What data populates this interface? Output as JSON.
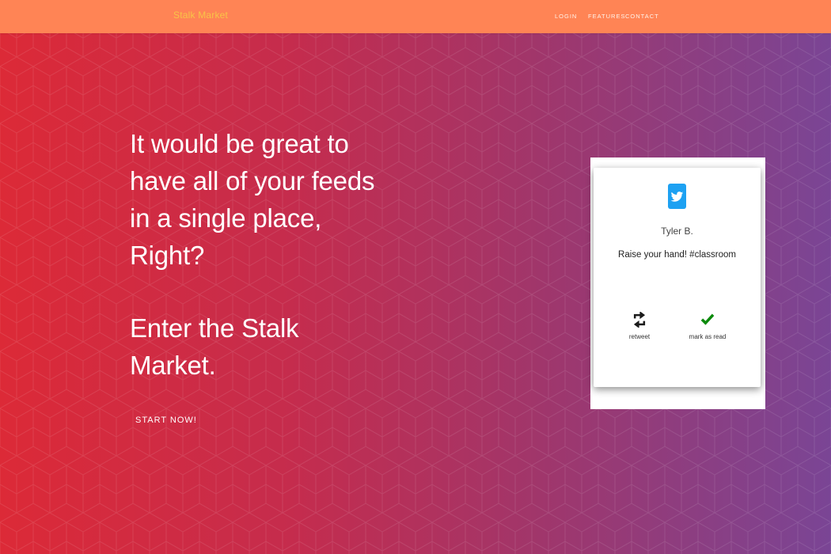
{
  "navbar": {
    "brand": "Stalk Market",
    "links": [
      "LOGIN",
      "FEATURES",
      "CONTACT"
    ]
  },
  "hero": {
    "line1": "It would be great to",
    "line2": "have all of your feeds",
    "line3": "in a single place,",
    "line4": "Right?",
    "line5": "Enter the Stalk",
    "line6": "Market.",
    "cta": "START NOW!"
  },
  "card": {
    "icon": "twitter-icon",
    "user": "Tyler B.",
    "tweet": "Raise your hand! #classroom",
    "actions": [
      {
        "icon": "retweet-icon",
        "label": "retweet"
      },
      {
        "icon": "checkmark-icon",
        "label": "mark as read"
      }
    ]
  },
  "colors": {
    "navbar": "#ff8455",
    "brand": "#f8c447",
    "gradient_start": "#dc2a37",
    "gradient_end": "#7a4595",
    "twitter": "#1da1f2",
    "check": "#0c8a0c"
  }
}
